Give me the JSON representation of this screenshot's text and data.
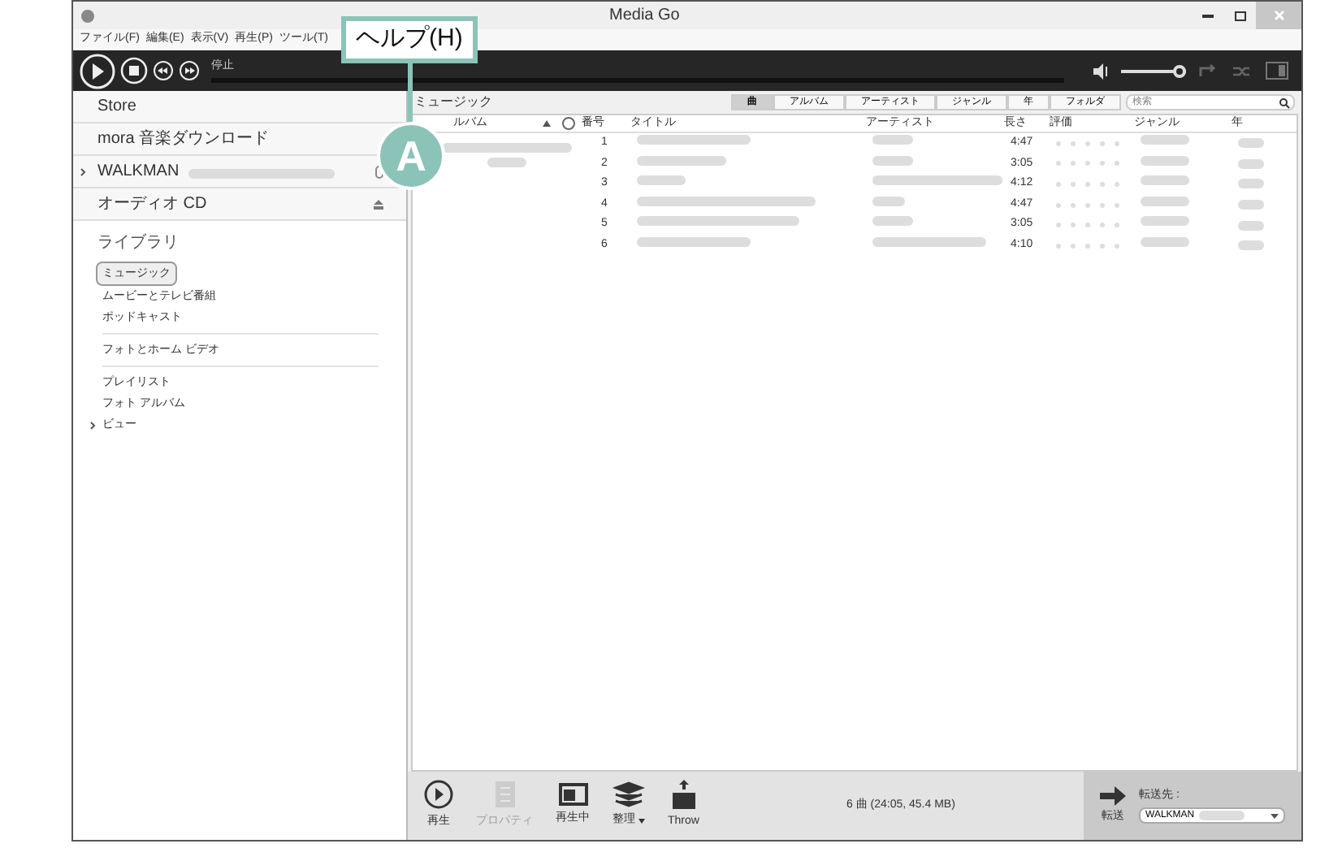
{
  "window": {
    "title": "Media Go"
  },
  "menu": [
    "ファイル(F)",
    "編集(E)",
    "表示(V)",
    "再生(P)",
    "ツール(T)"
  ],
  "callout": {
    "label": "ヘルプ(H)",
    "marker": "A"
  },
  "player": {
    "status": "停止",
    "volume": {
      "level": 1
    }
  },
  "sidebar": {
    "sections": [
      {
        "label": "Store",
        "kind": "plain"
      },
      {
        "label": "mora 音楽ダウンロード",
        "kind": "plain"
      },
      {
        "label": "WALKMAN",
        "kind": "device"
      },
      {
        "label": "オーディオ CD",
        "kind": "eject"
      }
    ],
    "library": {
      "label": "ライブラリ",
      "items": [
        {
          "label": "ミュージック",
          "selected": true,
          "divider_after": false
        },
        {
          "label": "ムービーとテレビ番組",
          "selected": false,
          "divider_after": false
        },
        {
          "label": "ポッドキャスト",
          "selected": false,
          "divider_after": true
        },
        {
          "label": "フォトとホーム ビデオ",
          "selected": false,
          "divider_after": true
        },
        {
          "label": "プレイリスト",
          "selected": false,
          "divider_after": false
        },
        {
          "label": "フォト アルバム",
          "selected": false,
          "divider_after": false
        },
        {
          "label": "ビュー",
          "selected": false,
          "divider_after": false
        }
      ]
    }
  },
  "content": {
    "title": "ミュージック",
    "views": [
      {
        "label": "曲",
        "selected": true
      },
      {
        "label": "アルバム",
        "selected": false
      },
      {
        "label": "アーティスト",
        "selected": false
      },
      {
        "label": "ジャンル",
        "selected": false
      },
      {
        "label": "年",
        "selected": false
      },
      {
        "label": "フォルダ",
        "selected": false
      }
    ],
    "search": {
      "placeholder": "検索"
    },
    "table": {
      "columns": [
        "ルバム",
        "番号",
        "タイトル",
        "アーティスト",
        "長さ",
        "評価",
        "ジャンル",
        "年"
      ],
      "rows": [
        {
          "number": "1",
          "length": "4:47",
          "stars": 0
        },
        {
          "number": "2",
          "length": "3:05",
          "stars": 0
        },
        {
          "number": "3",
          "length": "4:12",
          "stars": 0
        },
        {
          "number": "4",
          "length": "4:47",
          "stars": 0
        },
        {
          "number": "5",
          "length": "3:05",
          "stars": 0
        },
        {
          "number": "6",
          "length": "4:10",
          "stars": 0
        }
      ]
    }
  },
  "bottom_bar": {
    "actions": [
      {
        "label": "再生",
        "disabled": false
      },
      {
        "label": "プロパティ",
        "disabled": true
      },
      {
        "label": "再生中",
        "disabled": false
      },
      {
        "label": "整理",
        "disabled": false
      },
      {
        "label": "Throw",
        "disabled": false
      }
    ],
    "summary": "6 曲 (24:05, 45.4 MB)",
    "transfer": {
      "label": "転送",
      "target_label": "転送先 :",
      "target": "WALKMAN"
    }
  }
}
